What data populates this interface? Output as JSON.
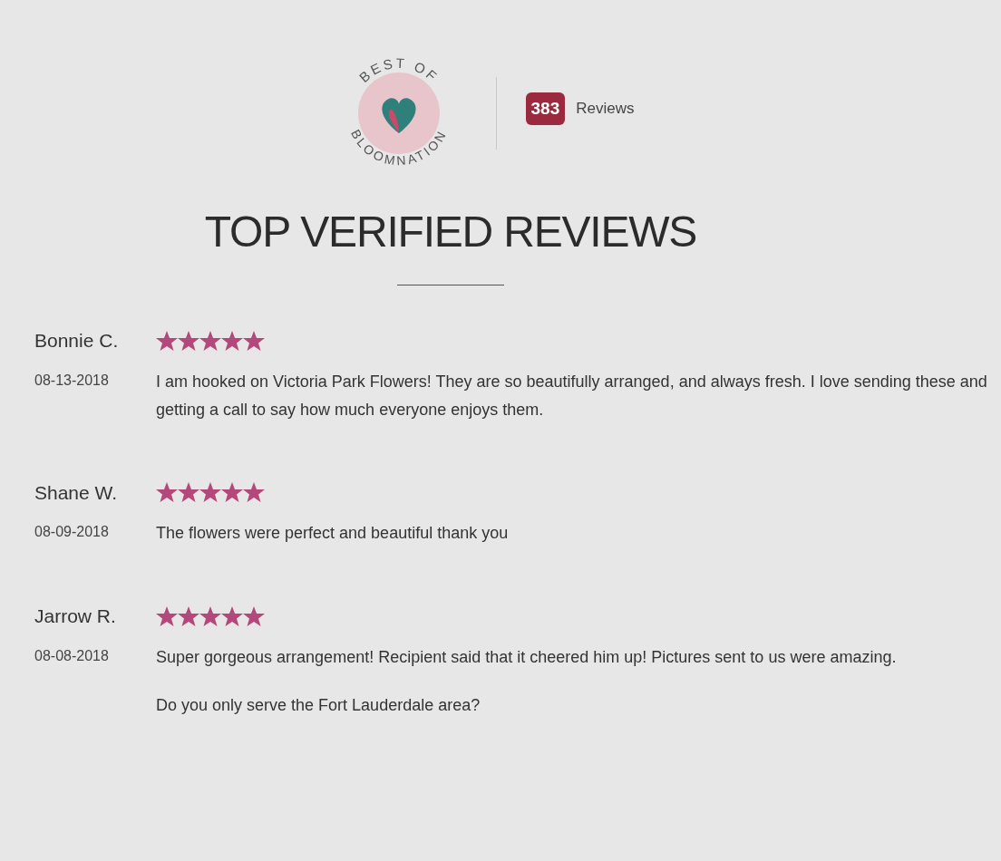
{
  "badge": {
    "top_text": "BEST OF",
    "bottom_text": "BLOOMNATION"
  },
  "review_count": {
    "count": "383",
    "label": "Reviews"
  },
  "title": "TOP VERIFIED REVIEWS",
  "reviews": [
    {
      "name": "Bonnie C.",
      "stars": 5,
      "date": "08-13-2018",
      "paragraphs": [
        "I am hooked on Victoria Park Flowers! They are so beautifully arranged, and always fresh. I love sending these and getting a call to say how much everyone enjoys them."
      ]
    },
    {
      "name": "Shane W.",
      "stars": 5,
      "date": "08-09-2018",
      "paragraphs": [
        "The flowers were perfect and beautiful thank you"
      ]
    },
    {
      "name": "Jarrow R.",
      "stars": 5,
      "date": "08-08-2018",
      "paragraphs": [
        "Super gorgeous arrangement! Recipient said that it cheered him up! Pictures sent to us were amazing.",
        "Do you only serve the Fort Lauderdale area?"
      ]
    }
  ]
}
